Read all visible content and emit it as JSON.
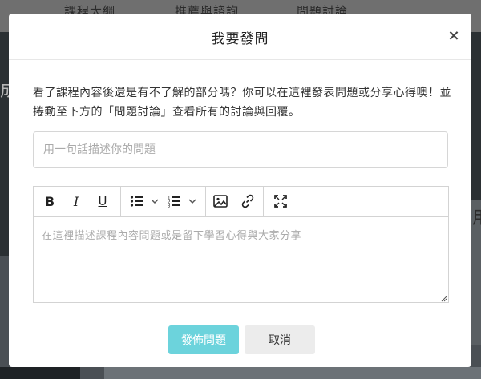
{
  "background": {
    "nav": [
      "課程大綱",
      "推薦與諮詢",
      "問題討論"
    ],
    "side_char": "成",
    "right_char": "用"
  },
  "modal": {
    "title": "我要發問",
    "close_label": "×",
    "description": "看了課程內容後還是有不了解的部分嗎？你可以在這裡發表問題或分享心得噢！並捲動至下方的「問題討論」查看所有的討論與回覆。",
    "title_input": {
      "value": "",
      "placeholder": "用一句話描述你的問題"
    },
    "editor": {
      "toolbar": [
        {
          "icon": "bold-icon",
          "glyph": "B"
        },
        {
          "icon": "italic-icon",
          "glyph": "I"
        },
        {
          "icon": "underline-icon",
          "glyph": "U"
        },
        {
          "icon": "bullet-list-icon"
        },
        {
          "icon": "numbered-list-icon"
        },
        {
          "icon": "image-icon"
        },
        {
          "icon": "link-icon"
        },
        {
          "icon": "fullscreen-icon"
        }
      ],
      "placeholder": "在這裡描述課程內容問題或是留下學習心得與大家分享"
    },
    "submit_label": "發佈問題",
    "cancel_label": "取消"
  },
  "colors": {
    "submit_bg": "#6cd3dc",
    "cancel_bg": "#ececec",
    "overlay": "#3a3f43"
  }
}
